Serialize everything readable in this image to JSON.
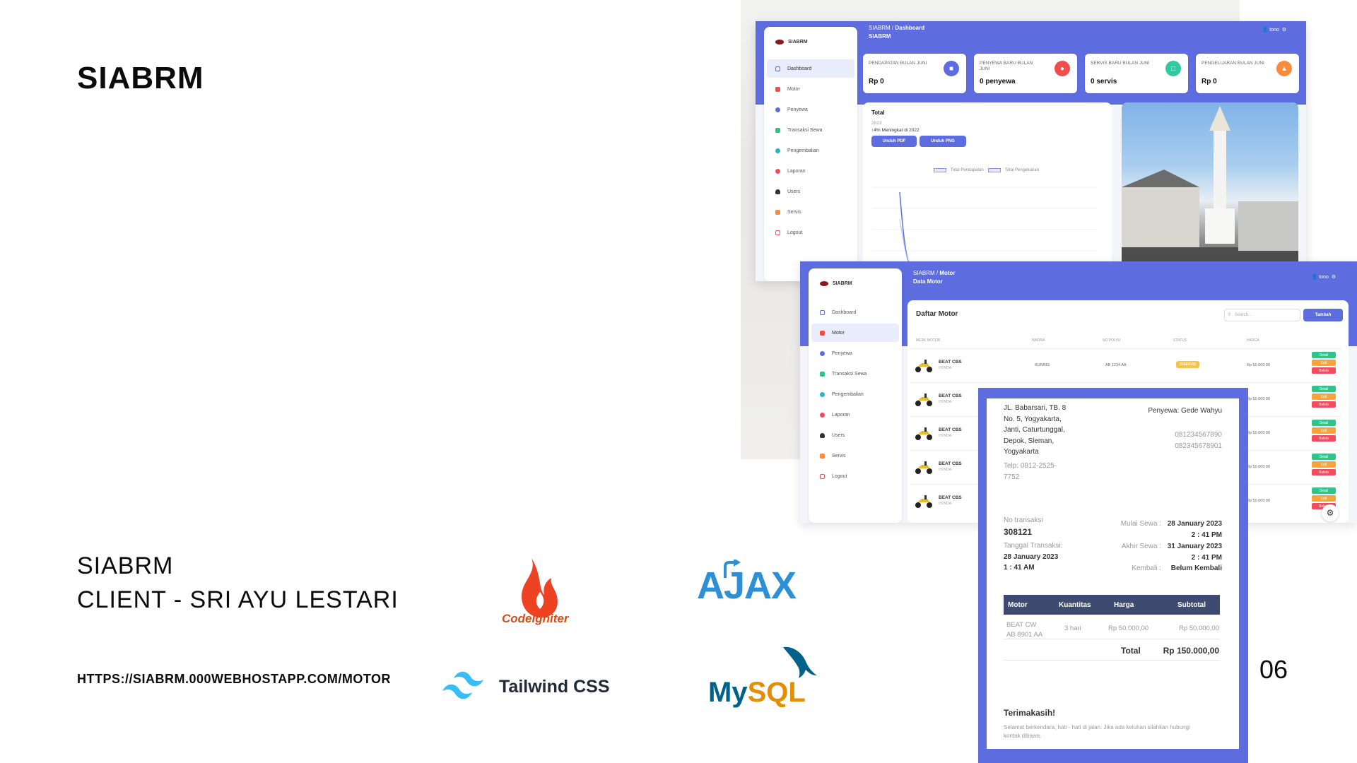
{
  "slide": {
    "title": "SIABRM",
    "project_name": "SIABRM",
    "client": "CLIENT - SRI AYU LESTARI",
    "url": "HTTPS://SIABRM.000WEBHOSTAPP.COM/MOTOR",
    "page_number": "06"
  },
  "logos": {
    "codeigniter": "CodeIgniter",
    "ajax": "AJAX",
    "tailwind": "Tailwind CSS",
    "mysql_my": "My",
    "mysql_sql": "SQL"
  },
  "dashboard": {
    "breadcrumb_root": "SIABRM",
    "breadcrumb_current": "Dashboard",
    "page_heading": "SIABRM",
    "user": "tono",
    "brand": "SIABRM",
    "nav": [
      "Dashboard",
      "Motor",
      "Penyewa",
      "Transaksi Sewa",
      "Pengembalian",
      "Laporan",
      "Users",
      "Servis",
      "Logout"
    ],
    "cards": [
      {
        "label": "PENDAPATAN BULAN JUNI",
        "value": "Rp 0",
        "color": "#5d6ddf"
      },
      {
        "label": "PENYEWA BARU BULAN JUNI",
        "value": "0 penyewa",
        "color": "#f24d4d"
      },
      {
        "label": "SERVIS BARU BULAN JUNI",
        "value": "0 servis",
        "color": "#33c9a0"
      },
      {
        "label": "PENGELUARAN BULAN JUNI",
        "value": "Rp 0",
        "color": "#fb8a3c"
      }
    ],
    "chart": {
      "title": "Total",
      "year": "2023",
      "growth": "4% Meningkat di 2022",
      "btn_pdf": "Unduh PDF",
      "btn_png": "Unduh PNG",
      "legend": [
        "Total Pendapatan",
        "Total Pengeluaran"
      ]
    }
  },
  "motor": {
    "breadcrumb_root": "SIABRM",
    "breadcrumb_current": "Motor",
    "page_heading": "Data Motor",
    "user": "tono",
    "brand": "SIABRM",
    "nav": [
      "Dashboard",
      "Motor",
      "Penyewa",
      "Transaksi Sewa",
      "Pengembalian",
      "Laporan",
      "Users",
      "Servis",
      "Logout"
    ],
    "title": "Daftar Motor",
    "search_placeholder": "Search...",
    "add_button": "Tambah",
    "columns": [
      "MERK MOTOR",
      "WARNA",
      "NO POLISI",
      "STATUS",
      "HARGA"
    ],
    "rows": [
      {
        "name": "BEAT CBS",
        "brand": "HONDA",
        "warna": "KUNING",
        "nopol": "AB 1234 AA",
        "status": "DISERVIS",
        "harga": "Rp 50.000,00"
      },
      {
        "name": "BEAT CBS",
        "brand": "HONDA",
        "harga": "Rp 50.000,00"
      },
      {
        "name": "BEAT CBS",
        "brand": "HONDA",
        "harga": "Rp 50.000,00"
      },
      {
        "name": "BEAT CBS",
        "brand": "HONDA",
        "harga": "Rp 50.000,00"
      },
      {
        "name": "BEAT CBS",
        "brand": "HONDA",
        "harga": "Rp 50.000,00"
      }
    ],
    "actions": {
      "detail": "Detail",
      "edit": "Edit",
      "delete": "Delete"
    }
  },
  "receipt": {
    "address": [
      "JL. Babarsari, TB. 8",
      "No. 5, Yogyakarta,",
      "Janti, Caturtunggal,",
      "Depok, Sleman,",
      "Yogyakarta"
    ],
    "telp": [
      "Telp: 0812-2525-",
      "7752"
    ],
    "penyewa": "Penyewa: Gede Wahyu",
    "phones": [
      "081234567890",
      "082345678901"
    ],
    "no_transaksi_label": "No transaksi",
    "no_transaksi": "308121",
    "tanggal_label": "Tanggal Transaksi:",
    "tanggal": "28 January 2023",
    "tanggal_time": "1 : 41 AM",
    "mulai_label": "Mulai Sewa :",
    "mulai_date": "28 January 2023",
    "mulai_time": "2 : 41 PM",
    "akhir_label": "Akhir Sewa :",
    "akhir_date": "31 January 2023",
    "akhir_time": "2 : 41 PM",
    "kembali_label": "Kembali :",
    "kembali_value": "Belum Kembali",
    "table_head": [
      "Motor",
      "Kuantitas",
      "Harga",
      "Subtotal"
    ],
    "item_name": "BEAT CW",
    "item_plate": "AB 8901 AA",
    "item_qty": "3 hari",
    "item_price": "Rp 50.000,00",
    "item_subtotal": "Rp 50.000,00",
    "total_label": "Total",
    "total_value": "Rp 150.000,00",
    "thanks": "Terimakasih!",
    "note": [
      "Selamat berkendara, hati - hati di jalan. Jika ada keluhan silahkan hubungi",
      "kontak dibawa."
    ]
  },
  "colors": {
    "accent": "#5d6ddf",
    "badge_yellow": "#f6c34a",
    "detail": "#33c38a",
    "edit": "#f6a53a",
    "delete": "#f24d5e"
  }
}
